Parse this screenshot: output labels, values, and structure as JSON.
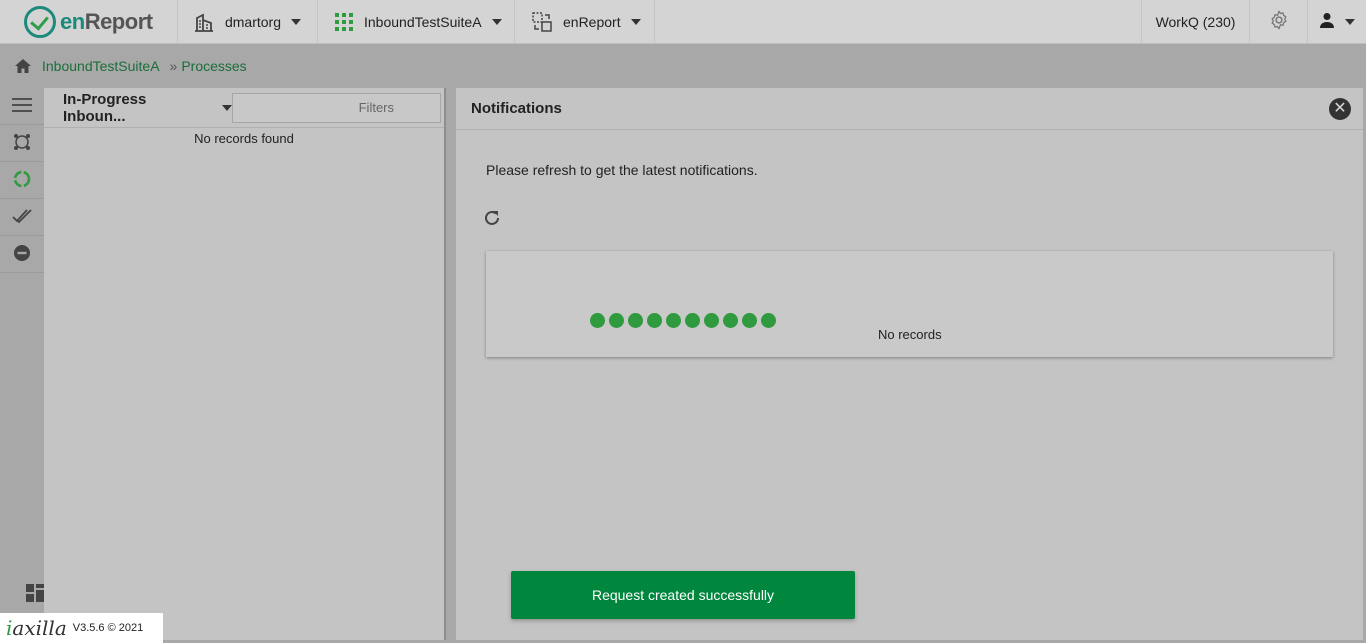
{
  "topbar": {
    "logo_text_a": "en",
    "logo_text_b": "Report",
    "org_label": "dmartorg",
    "app_label": "InboundTestSuiteA",
    "module_label": "enReport",
    "workq_label": "WorkQ (230)"
  },
  "breadcrumb": {
    "items": [
      "InboundTestSuiteA",
      "Processes"
    ],
    "separator": "»"
  },
  "list_panel": {
    "title": "In-Progress Inboun...",
    "filters_placeholder": "Filters",
    "empty_text": "No records found"
  },
  "notifications": {
    "title": "Notifications",
    "close_label": "✕",
    "refresh_message": "Please refresh to get the latest notifications.",
    "empty_text": "No records",
    "loading_dot_count": 10
  },
  "toast": {
    "message": "Request created successfully"
  },
  "footer": {
    "brand_a": "a",
    "brand_b": "xilla",
    "version": "V3.5.6 © 2021"
  },
  "colors": {
    "accent_green": "#00873d",
    "link_green": "#1a6e3a",
    "dot_green": "#2f9a3e",
    "logo_teal": "#1c8a7a"
  },
  "icons": {
    "home": "home-icon",
    "org": "building-icon",
    "app": "apps-grid-icon",
    "module": "module-switch-icon",
    "settings": "gear-icon",
    "user": "user-icon",
    "rail": [
      "menu-icon",
      "process-icon",
      "loading-circle-icon",
      "check-icon",
      "minus-circle-icon",
      "dashboard-icon"
    ],
    "refresh": "refresh-icon",
    "close": "close-icon"
  }
}
